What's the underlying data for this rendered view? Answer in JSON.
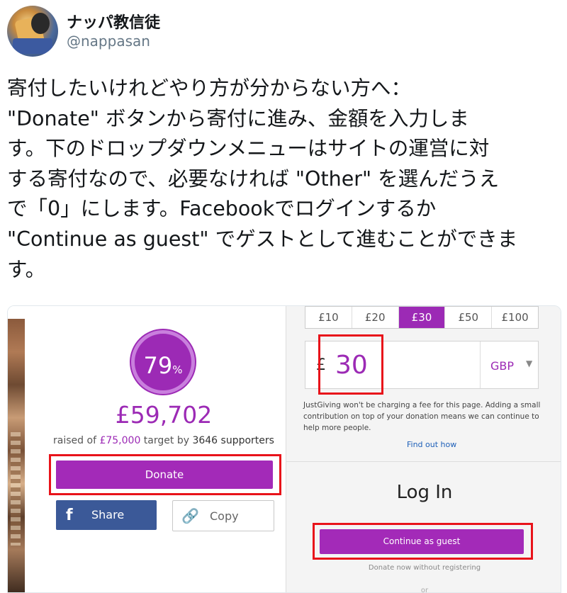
{
  "tweet": {
    "display_name": "ナッパ教信徒",
    "handle": "@nappasan",
    "text_lines": [
      "寄付したいけれどやり方が分からない方へ：",
      "\"Donate\" ボタンから寄付に進み、金額を入力しま",
      "す。下のドロップダウンメニューはサイトの運営に対",
      "する寄付なので、必要なければ \"Other\" を選んだうえ",
      "で「0」にします。Facebookでログインするか",
      "\"Continue as guest\" でゲストとして進むことができま",
      "す。"
    ]
  },
  "screenshot": {
    "progress": {
      "percent_value": "79",
      "percent_sign": "%",
      "fraction": 0.79
    },
    "amount_raised": "£59,702",
    "raised_line": {
      "prefix": "raised of ",
      "target": "£75,000",
      "mid": " target by ",
      "supporters": "3646 supporters"
    },
    "donate_label": "Donate",
    "share_label": "Share",
    "copy_label": "Copy",
    "amount_tabs": [
      {
        "label": "£10",
        "active": false
      },
      {
        "label": "£20",
        "active": false
      },
      {
        "label": "£30",
        "active": true
      },
      {
        "label": "£50",
        "active": false
      },
      {
        "label": "£100",
        "active": false
      }
    ],
    "currency_symbol": "£",
    "amount_value": "30",
    "currency_code": "GBP",
    "fee_note": "JustGiving won't be charging a fee for this page. Adding a small contribution on top of your donation means we can continue to help more people.",
    "find_out_how": "Find out how",
    "login_title": "Log In",
    "continue_guest": "Continue as guest",
    "donate_without": "Donate now without registering",
    "or_text": "or"
  },
  "colors": {
    "accent": "#9c2ab5",
    "highlight_box": "#e8131a",
    "facebook": "#3b5998",
    "link": "#1d5fb8"
  },
  "icons": [
    "facebook-icon",
    "link-icon",
    "chevron-down-icon"
  ]
}
